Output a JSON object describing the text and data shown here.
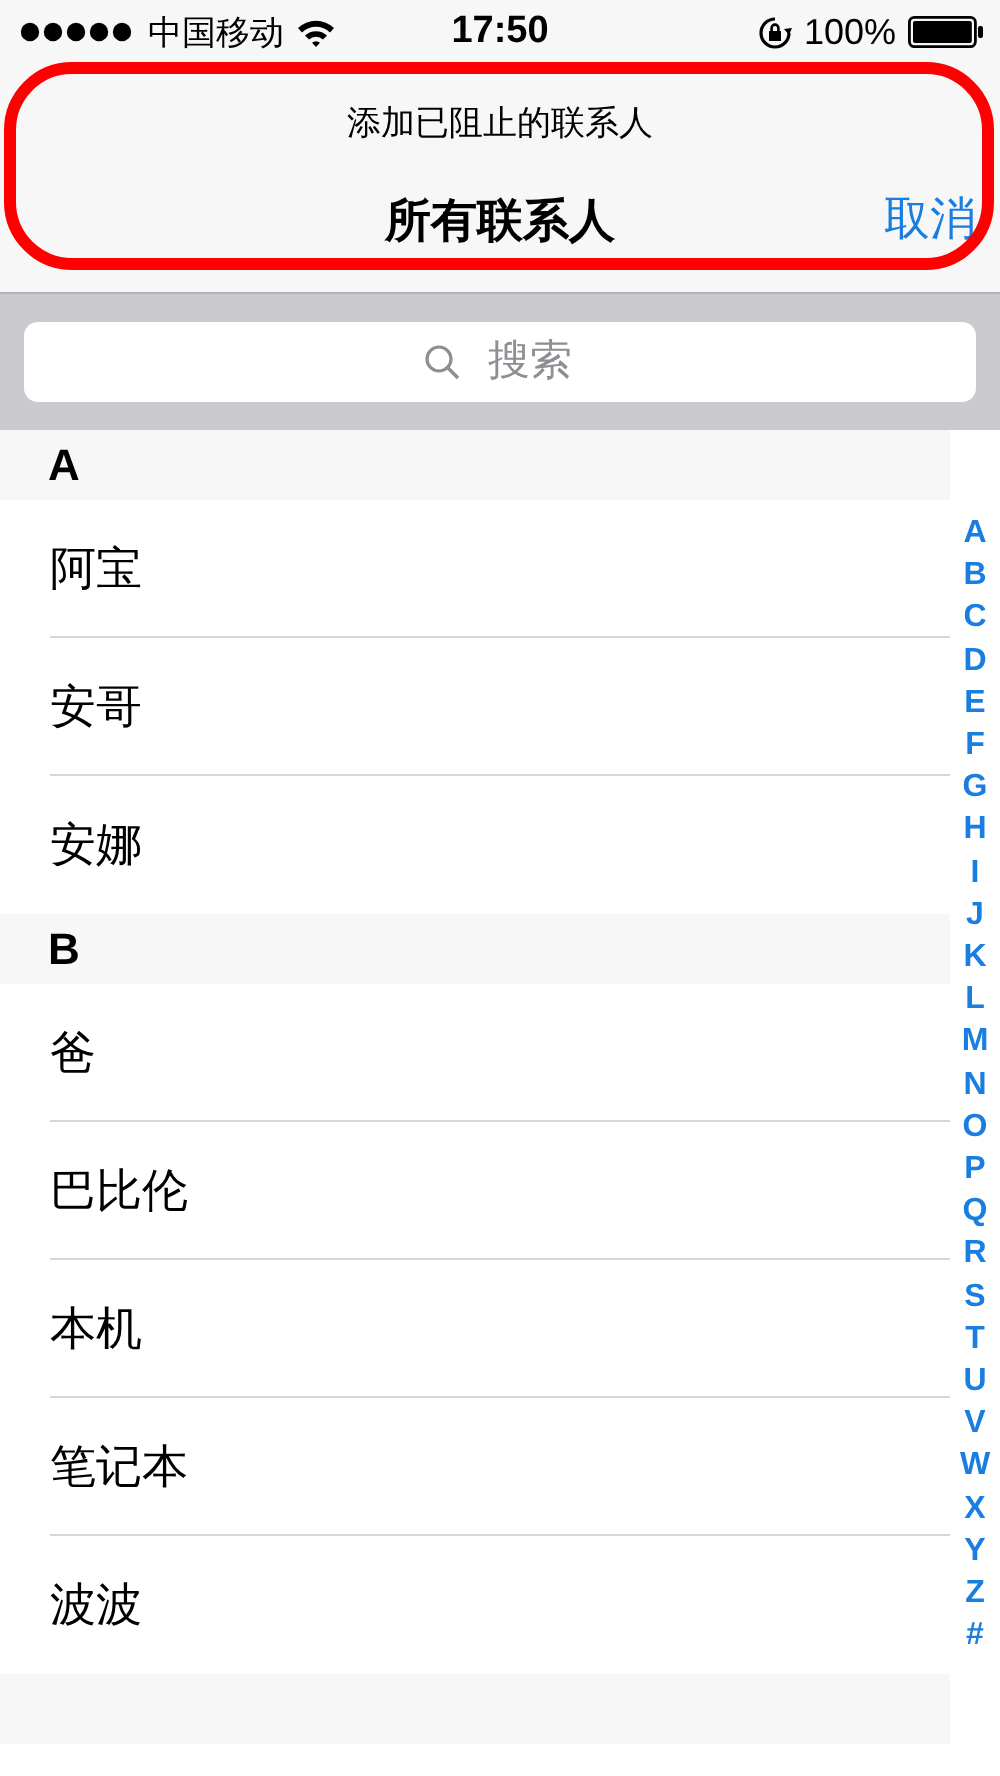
{
  "status_bar": {
    "carrier": "中国移动",
    "time": "17:50",
    "battery": "100%"
  },
  "nav": {
    "prompt": "添加已阻止的联系人",
    "title": "所有联系人",
    "cancel": "取消"
  },
  "highlight": {
    "kind": "outline"
  },
  "search": {
    "placeholder": "搜索"
  },
  "sections": [
    {
      "letter": "A",
      "contacts": [
        "阿宝",
        "安哥",
        "安娜"
      ]
    },
    {
      "letter": "B",
      "contacts": [
        "爸",
        "巴比伦",
        "本机",
        "笔记本",
        "波波"
      ]
    }
  ],
  "index": [
    "A",
    "B",
    "C",
    "D",
    "E",
    "F",
    "G",
    "H",
    "I",
    "J",
    "K",
    "L",
    "M",
    "N",
    "O",
    "P",
    "Q",
    "R",
    "S",
    "T",
    "U",
    "V",
    "W",
    "X",
    "Y",
    "Z",
    "#"
  ]
}
